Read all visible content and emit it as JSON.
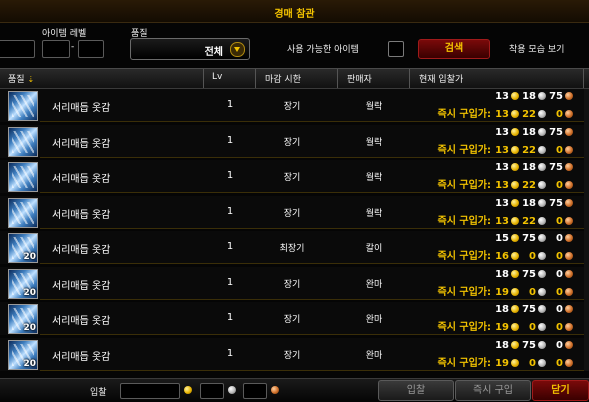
{
  "window": {
    "title": "경매 참관"
  },
  "filters": {
    "item_level_label": "아이템 레벨",
    "level_separator": "-",
    "quality_label": "품질",
    "quality_value": "전체",
    "usable_only_label": "사용 가능한 아이템",
    "search_label": "검색",
    "preview_label": "착용 모습 보기"
  },
  "table": {
    "headers": {
      "quality": "품질",
      "sort_arrow": "⇣",
      "level": "Lv",
      "time": "마감 시한",
      "seller": "판매자",
      "bid": "현재 입찰가"
    },
    "buyout_label": "즉시 구입가:",
    "rows": [
      {
        "name": "서리매듭 옷감",
        "stack": "",
        "level": "1",
        "time": "장기",
        "seller": "월락",
        "bid": [
          "13",
          "18",
          "75"
        ],
        "buyout": [
          "13",
          "22",
          "0"
        ]
      },
      {
        "name": "서리매듭 옷감",
        "stack": "",
        "level": "1",
        "time": "장기",
        "seller": "월락",
        "bid": [
          "13",
          "18",
          "75"
        ],
        "buyout": [
          "13",
          "22",
          "0"
        ]
      },
      {
        "name": "서리매듭 옷감",
        "stack": "",
        "level": "1",
        "time": "장기",
        "seller": "월락",
        "bid": [
          "13",
          "18",
          "75"
        ],
        "buyout": [
          "13",
          "22",
          "0"
        ]
      },
      {
        "name": "서리매듭 옷감",
        "stack": "",
        "level": "1",
        "time": "장기",
        "seller": "월락",
        "bid": [
          "13",
          "18",
          "75"
        ],
        "buyout": [
          "13",
          "22",
          "0"
        ]
      },
      {
        "name": "서리매듭 옷감",
        "stack": "20",
        "level": "1",
        "time": "최장기",
        "seller": "칼이",
        "bid": [
          "15",
          "75",
          "0"
        ],
        "buyout": [
          "16",
          "0",
          "0"
        ]
      },
      {
        "name": "서리매듭 옷감",
        "stack": "20",
        "level": "1",
        "time": "장기",
        "seller": "완마",
        "bid": [
          "18",
          "75",
          "0"
        ],
        "buyout": [
          "19",
          "0",
          "0"
        ]
      },
      {
        "name": "서리매듭 옷감",
        "stack": "20",
        "level": "1",
        "time": "장기",
        "seller": "완마",
        "bid": [
          "18",
          "75",
          "0"
        ],
        "buyout": [
          "19",
          "0",
          "0"
        ]
      },
      {
        "name": "서리매듭 옷감",
        "stack": "20",
        "level": "1",
        "time": "장기",
        "seller": "완마",
        "bid": [
          "18",
          "75",
          "0"
        ],
        "buyout": [
          "19",
          "0",
          "0"
        ]
      }
    ]
  },
  "footer": {
    "bid_label": "입찰",
    "bid_button": "입찰",
    "buyout_button": "즉시 구입",
    "close_button": "닫기"
  }
}
